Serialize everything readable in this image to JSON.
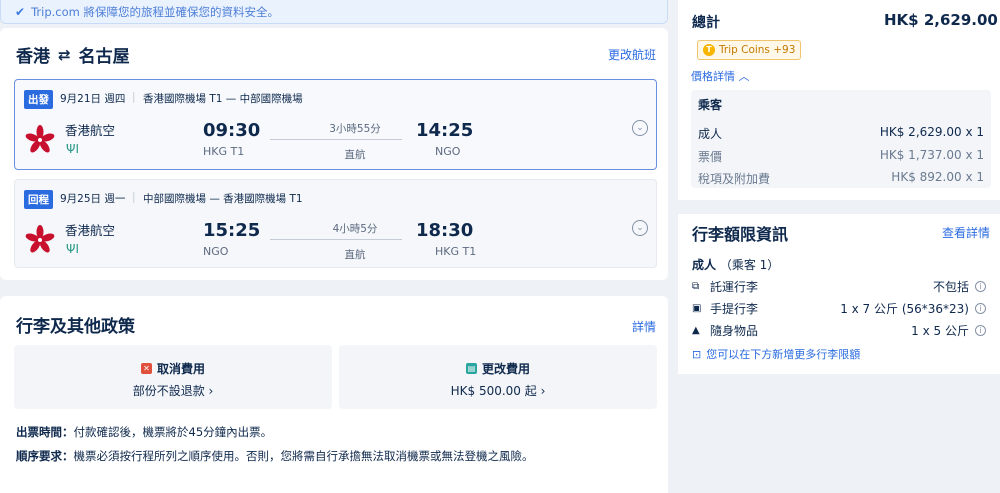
{
  "banner": {
    "text": "Trip.com 將保障您的旅程並確保您的資料安全。"
  },
  "route": {
    "from": "香港",
    "to": "名古屋",
    "change_label": "更改航班"
  },
  "segments": [
    {
      "tag": "出發",
      "date": "9月21日 週四",
      "airports": "香港國際機場 T1 — 中部國際機場",
      "airline": "香港航空",
      "dep_time": "09:30",
      "dep_code": "HKG T1",
      "duration": "3小時55分",
      "stops": "直航",
      "arr_time": "14:25",
      "arr_code": "NGO"
    },
    {
      "tag": "回程",
      "date": "9月25日 週一",
      "airports": "中部國際機場 — 香港國際機場 T1",
      "airline": "香港航空",
      "dep_time": "15:25",
      "dep_code": "NGO",
      "duration": "4小時5分",
      "stops": "直航",
      "arr_time": "18:30",
      "arr_code": "HKG T1"
    }
  ],
  "policy": {
    "title": "行李及其他政策",
    "detail_label": "詳情",
    "cancel": {
      "title": "取消費用",
      "value": "部份不設退款 ›"
    },
    "change": {
      "title": "更改費用",
      "value": "HK$ 500.00 起 ›"
    },
    "ticketing_label": "出票時間：",
    "ticketing_text": "付款確認後，機票將於45分鐘內出票。",
    "order_label": "順序要求：",
    "order_text": "機票必須按行程所列之順序使用。否則，您將需自行承擔無法取消機票或無法登機之風險。"
  },
  "total": {
    "label": "總計",
    "price": "HK$ 2,629.00",
    "coins": "Trip Coins +93",
    "price_detail": "價格詳情 ︿",
    "pax_title": "乘客",
    "rows": [
      {
        "label": "成人",
        "value": "HK$ 2,629.00 x 1"
      },
      {
        "label": "票價",
        "value": "HK$ 1,737.00 x 1"
      },
      {
        "label": "稅項及附加費",
        "value": "HK$ 892.00 x 1"
      }
    ]
  },
  "baggage": {
    "title": "行李額限資訊",
    "detail_label": "查看詳情",
    "pax_label": "成人",
    "pax_sub": "（乘客 1）",
    "rows": [
      {
        "label": "託運行李",
        "value": "不包括"
      },
      {
        "label": "手提行李",
        "value": "1 x 7 公斤 (56*36*23)"
      },
      {
        "label": "隨身物品",
        "value": "1 x 5 公斤"
      }
    ],
    "add_text": "您可以在下方新增更多行李限額"
  },
  "colors": {
    "accent": "#2a6be0",
    "text": "#0f294d",
    "airline_red": "#c8102e"
  }
}
